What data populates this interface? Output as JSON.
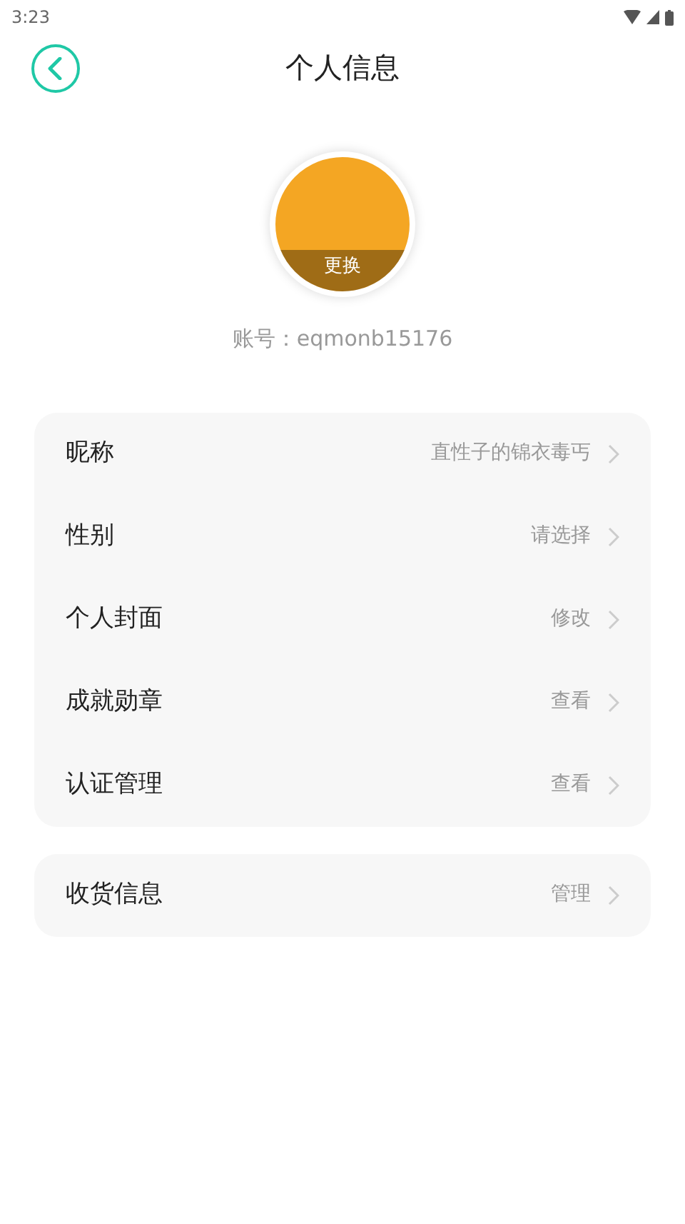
{
  "status_bar": {
    "time": "3:23"
  },
  "header": {
    "title": "个人信息"
  },
  "avatar": {
    "action": "更换"
  },
  "account": "账号：eqmonb15176",
  "groups": [
    {
      "rows": [
        {
          "label": "昵称",
          "value": "直性子的锦衣毒丐"
        },
        {
          "label": "性别",
          "value": "请选择"
        },
        {
          "label": "个人封面",
          "value": "修改"
        },
        {
          "label": "成就勋章",
          "value": "查看"
        },
        {
          "label": "认证管理",
          "value": "查看"
        }
      ]
    },
    {
      "rows": [
        {
          "label": "收货信息",
          "value": "管理"
        }
      ]
    }
  ]
}
